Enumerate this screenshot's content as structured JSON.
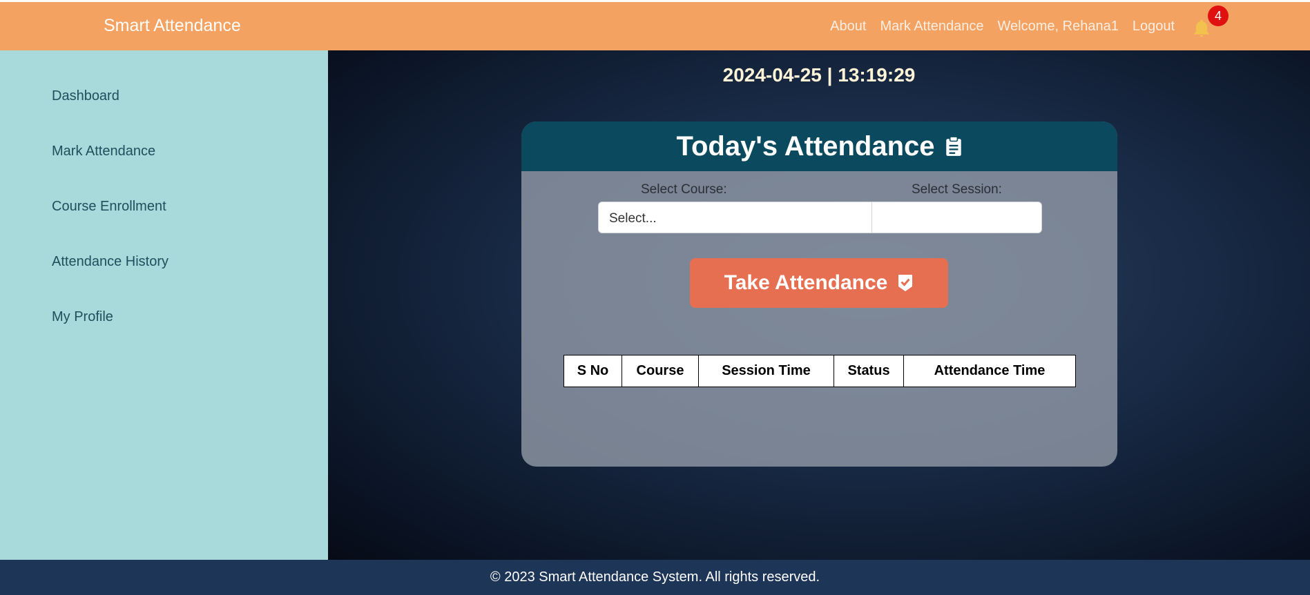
{
  "header": {
    "brand": "Smart Attendance",
    "nav": [
      "About",
      "Mark Attendance",
      "Welcome, Rehana1",
      "Logout"
    ],
    "notification_count": "4",
    "bg_color": "#f4a261"
  },
  "sidebar": {
    "items": [
      "Dashboard",
      "Mark Attendance",
      "Course Enrollment",
      "Attendance History",
      "My Profile"
    ],
    "bg_color": "#a8dadc"
  },
  "main": {
    "datetime": "2024-04-25 | 13:19:29",
    "card": {
      "title": "Today's Attendance",
      "course_label": "Select Course:",
      "session_label": "Select Session:",
      "course_value": "Select...",
      "session_value": "",
      "take_button": "Take Attendance",
      "table_headers": [
        "S No",
        "Course",
        "Session Time",
        "Status",
        "Attendance Time"
      ],
      "table_rows": []
    }
  },
  "footer": {
    "text": "© 2023 Smart Attendance System. All rights reserved.",
    "bg_color": "#1d3557"
  },
  "colors": {
    "accent_button": "#e76f51",
    "card_header": "#0b4a5e",
    "notification_badge": "#e01010"
  },
  "icons": [
    "bell-icon",
    "clipboard-icon",
    "check-shield-icon"
  ]
}
